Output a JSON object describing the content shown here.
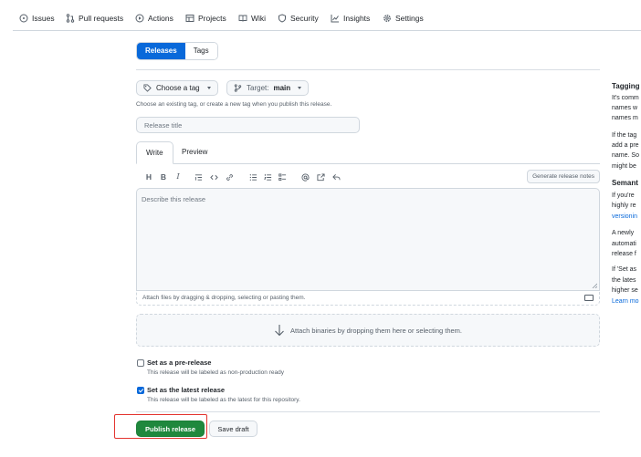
{
  "nav": {
    "items": [
      {
        "label": "Issues",
        "icon": "issue-opened-icon"
      },
      {
        "label": "Pull requests",
        "icon": "git-pull-request-icon"
      },
      {
        "label": "Actions",
        "icon": "play-icon"
      },
      {
        "label": "Projects",
        "icon": "table-icon"
      },
      {
        "label": "Wiki",
        "icon": "book-icon"
      },
      {
        "label": "Security",
        "icon": "shield-icon"
      },
      {
        "label": "Insights",
        "icon": "graph-icon"
      },
      {
        "label": "Settings",
        "icon": "gear-icon"
      }
    ]
  },
  "segment": {
    "releases": "Releases",
    "tags": "Tags"
  },
  "tag": {
    "choose_label": "Choose a tag",
    "target_prefix": "Target:",
    "target_value": "main",
    "hint": "Choose an existing tag, or create a new tag when you publish this release."
  },
  "title_input": {
    "placeholder": "Release title"
  },
  "editor": {
    "tab_write": "Write",
    "tab_preview": "Preview",
    "toolbar": {
      "heading": "H",
      "bold": "B",
      "italic": "I"
    },
    "generate_notes": "Generate release notes",
    "placeholder": "Describe this release",
    "attach_hint": "Attach files by dragging & dropping, selecting or pasting them."
  },
  "binaries": {
    "text": "Attach binaries by dropping them here or selecting them."
  },
  "prerelease": {
    "title": "Set as a pre-release",
    "desc": "This release will be labeled as non-production ready",
    "checked": false
  },
  "latest": {
    "title": "Set as the latest release",
    "desc": "This release will be labeled as the latest for this repository.",
    "checked": true
  },
  "actions": {
    "publish": "Publish release",
    "save_draft": "Save draft"
  },
  "sidebar": {
    "heading1": "Tagging",
    "p1": [
      "It's comm",
      "names w",
      "names m"
    ],
    "p2": [
      "If the tag",
      "add a pre",
      "name. So",
      "might be"
    ],
    "heading2": "Semant",
    "p3": [
      "If you're",
      "highly re"
    ],
    "p3_link": "versionin",
    "p4": [
      "A newly",
      "automati",
      "release f"
    ],
    "p5": [
      "If 'Set as",
      "the lates",
      "higher se"
    ],
    "p5_link": "Learn mo"
  },
  "colors": {
    "primary_blue": "#0969da",
    "publish_green": "#1f883d",
    "highlight_red": "#e3342f"
  }
}
